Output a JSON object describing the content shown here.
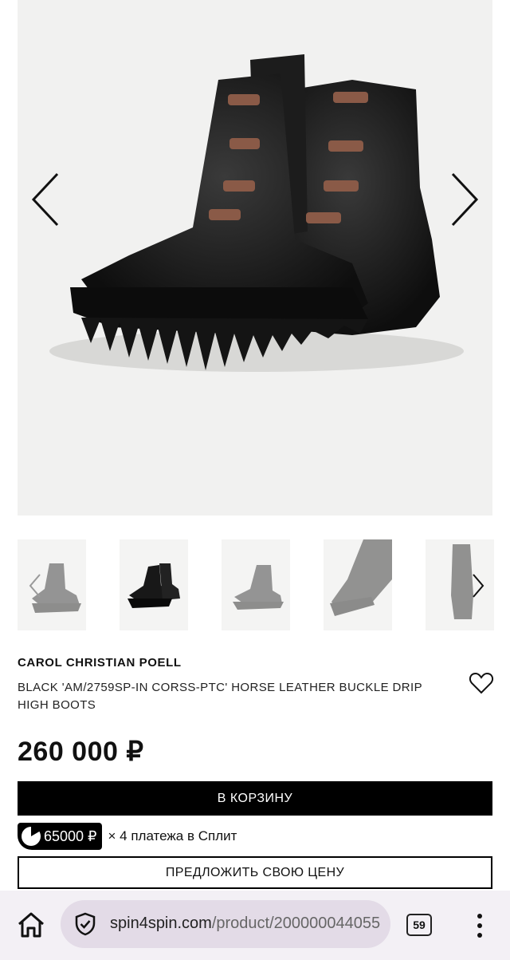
{
  "gallery": {
    "prev_icon": "chevron-left-icon",
    "next_icon": "chevron-right-icon"
  },
  "thumbnails": {
    "count": 5,
    "active_index": 1,
    "prev_icon": "chevron-left-icon",
    "next_icon": "chevron-right-icon"
  },
  "product": {
    "brand": "CAROL CHRISTIAN POELL",
    "title": "BLACK 'AM/2759SP-IN CORSS-PTC' HORSE LEATHER BUCKLE DRIP HIGH BOOTS",
    "price": "260 000 ₽",
    "favorite_icon": "heart-icon"
  },
  "actions": {
    "cart_label": "В КОРЗИНУ",
    "offer_label": "ПРЕДЛОЖИТЬ СВОЮ ЦЕНУ"
  },
  "split": {
    "amount": "65000 ₽",
    "text": "× 4 платежа в Сплит",
    "logo_icon": "split-logo-icon"
  },
  "browser": {
    "home_icon": "home-icon",
    "security_icon": "shield-check-icon",
    "url_host": "spin4spin.com",
    "url_path": "/product/200000044055",
    "tab_count": "59",
    "menu_icon": "more-vertical-icon"
  },
  "colors": {
    "black": "#000000",
    "gallery_bg": "#f1f1f0",
    "browser_bar": "#f3f0f5",
    "url_pill": "#e3dbe7"
  }
}
